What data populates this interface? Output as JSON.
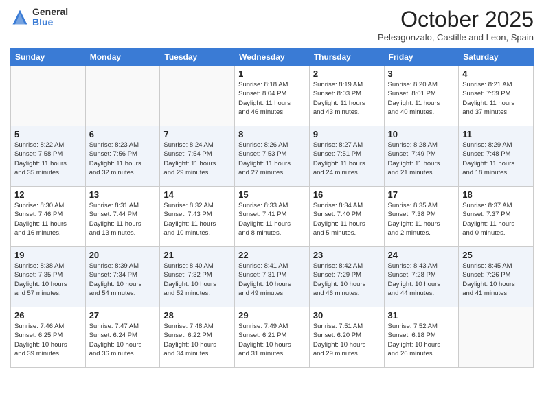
{
  "header": {
    "logo_general": "General",
    "logo_blue": "Blue",
    "month_title": "October 2025",
    "location": "Peleagonzalo, Castille and Leon, Spain"
  },
  "weekdays": [
    "Sunday",
    "Monday",
    "Tuesday",
    "Wednesday",
    "Thursday",
    "Friday",
    "Saturday"
  ],
  "weeks": [
    [
      {
        "day": "",
        "info": ""
      },
      {
        "day": "",
        "info": ""
      },
      {
        "day": "",
        "info": ""
      },
      {
        "day": "1",
        "info": "Sunrise: 8:18 AM\nSunset: 8:04 PM\nDaylight: 11 hours\nand 46 minutes."
      },
      {
        "day": "2",
        "info": "Sunrise: 8:19 AM\nSunset: 8:03 PM\nDaylight: 11 hours\nand 43 minutes."
      },
      {
        "day": "3",
        "info": "Sunrise: 8:20 AM\nSunset: 8:01 PM\nDaylight: 11 hours\nand 40 minutes."
      },
      {
        "day": "4",
        "info": "Sunrise: 8:21 AM\nSunset: 7:59 PM\nDaylight: 11 hours\nand 37 minutes."
      }
    ],
    [
      {
        "day": "5",
        "info": "Sunrise: 8:22 AM\nSunset: 7:58 PM\nDaylight: 11 hours\nand 35 minutes."
      },
      {
        "day": "6",
        "info": "Sunrise: 8:23 AM\nSunset: 7:56 PM\nDaylight: 11 hours\nand 32 minutes."
      },
      {
        "day": "7",
        "info": "Sunrise: 8:24 AM\nSunset: 7:54 PM\nDaylight: 11 hours\nand 29 minutes."
      },
      {
        "day": "8",
        "info": "Sunrise: 8:26 AM\nSunset: 7:53 PM\nDaylight: 11 hours\nand 27 minutes."
      },
      {
        "day": "9",
        "info": "Sunrise: 8:27 AM\nSunset: 7:51 PM\nDaylight: 11 hours\nand 24 minutes."
      },
      {
        "day": "10",
        "info": "Sunrise: 8:28 AM\nSunset: 7:49 PM\nDaylight: 11 hours\nand 21 minutes."
      },
      {
        "day": "11",
        "info": "Sunrise: 8:29 AM\nSunset: 7:48 PM\nDaylight: 11 hours\nand 18 minutes."
      }
    ],
    [
      {
        "day": "12",
        "info": "Sunrise: 8:30 AM\nSunset: 7:46 PM\nDaylight: 11 hours\nand 16 minutes."
      },
      {
        "day": "13",
        "info": "Sunrise: 8:31 AM\nSunset: 7:44 PM\nDaylight: 11 hours\nand 13 minutes."
      },
      {
        "day": "14",
        "info": "Sunrise: 8:32 AM\nSunset: 7:43 PM\nDaylight: 11 hours\nand 10 minutes."
      },
      {
        "day": "15",
        "info": "Sunrise: 8:33 AM\nSunset: 7:41 PM\nDaylight: 11 hours\nand 8 minutes."
      },
      {
        "day": "16",
        "info": "Sunrise: 8:34 AM\nSunset: 7:40 PM\nDaylight: 11 hours\nand 5 minutes."
      },
      {
        "day": "17",
        "info": "Sunrise: 8:35 AM\nSunset: 7:38 PM\nDaylight: 11 hours\nand 2 minutes."
      },
      {
        "day": "18",
        "info": "Sunrise: 8:37 AM\nSunset: 7:37 PM\nDaylight: 11 hours\nand 0 minutes."
      }
    ],
    [
      {
        "day": "19",
        "info": "Sunrise: 8:38 AM\nSunset: 7:35 PM\nDaylight: 10 hours\nand 57 minutes."
      },
      {
        "day": "20",
        "info": "Sunrise: 8:39 AM\nSunset: 7:34 PM\nDaylight: 10 hours\nand 54 minutes."
      },
      {
        "day": "21",
        "info": "Sunrise: 8:40 AM\nSunset: 7:32 PM\nDaylight: 10 hours\nand 52 minutes."
      },
      {
        "day": "22",
        "info": "Sunrise: 8:41 AM\nSunset: 7:31 PM\nDaylight: 10 hours\nand 49 minutes."
      },
      {
        "day": "23",
        "info": "Sunrise: 8:42 AM\nSunset: 7:29 PM\nDaylight: 10 hours\nand 46 minutes."
      },
      {
        "day": "24",
        "info": "Sunrise: 8:43 AM\nSunset: 7:28 PM\nDaylight: 10 hours\nand 44 minutes."
      },
      {
        "day": "25",
        "info": "Sunrise: 8:45 AM\nSunset: 7:26 PM\nDaylight: 10 hours\nand 41 minutes."
      }
    ],
    [
      {
        "day": "26",
        "info": "Sunrise: 7:46 AM\nSunset: 6:25 PM\nDaylight: 10 hours\nand 39 minutes."
      },
      {
        "day": "27",
        "info": "Sunrise: 7:47 AM\nSunset: 6:24 PM\nDaylight: 10 hours\nand 36 minutes."
      },
      {
        "day": "28",
        "info": "Sunrise: 7:48 AM\nSunset: 6:22 PM\nDaylight: 10 hours\nand 34 minutes."
      },
      {
        "day": "29",
        "info": "Sunrise: 7:49 AM\nSunset: 6:21 PM\nDaylight: 10 hours\nand 31 minutes."
      },
      {
        "day": "30",
        "info": "Sunrise: 7:51 AM\nSunset: 6:20 PM\nDaylight: 10 hours\nand 29 minutes."
      },
      {
        "day": "31",
        "info": "Sunrise: 7:52 AM\nSunset: 6:18 PM\nDaylight: 10 hours\nand 26 minutes."
      },
      {
        "day": "",
        "info": ""
      }
    ]
  ]
}
